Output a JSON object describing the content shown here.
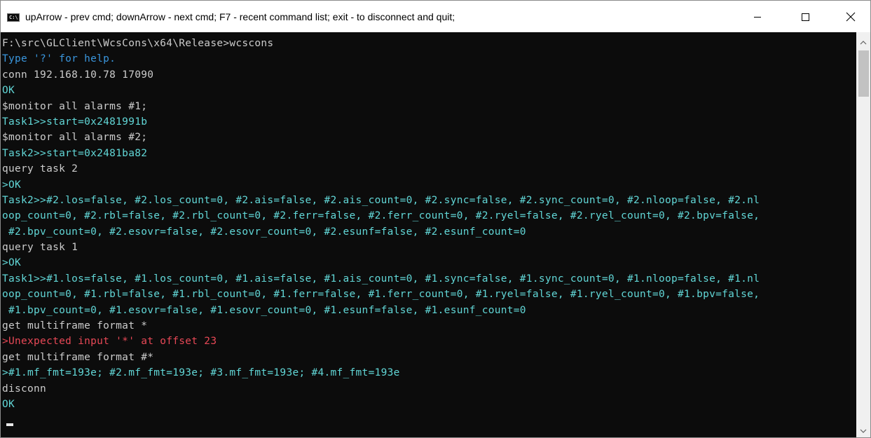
{
  "window": {
    "title": "upArrow - prev cmd; downArrow - next cmd; F7 - recent command list; exit - to disconnect and quit;",
    "icon": "console-app-icon",
    "icon_label": "C:\\",
    "controls": [
      "minimize-icon",
      "maximize-icon",
      "close-icon"
    ]
  },
  "console": {
    "lines": [
      {
        "text": "F:\\src\\GLClient\\WcsCons\\x64\\Release>wcscons",
        "color": "#cccccc"
      },
      {
        "text": "Type '?' for help.",
        "color": "#3a96dd"
      },
      {
        "text": "conn 192.168.10.78 17090",
        "color": "#cccccc"
      },
      {
        "text": "OK",
        "color": "#61d6d6"
      },
      {
        "text": "$monitor all alarms #1;",
        "color": "#cccccc"
      },
      {
        "text": "Task1>>start=0x2481991b",
        "color": "#61d6d6"
      },
      {
        "text": "$monitor all alarms #2;",
        "color": "#cccccc"
      },
      {
        "text": "Task2>>start=0x2481ba82",
        "color": "#61d6d6"
      },
      {
        "text": "query task 2",
        "color": "#cccccc"
      },
      {
        "text": ">OK",
        "color": "#61d6d6"
      },
      {
        "text": "Task2>>#2.los=false, #2.los_count=0, #2.ais=false, #2.ais_count=0, #2.sync=false, #2.sync_count=0, #2.nloop=false, #2.nl",
        "color": "#61d6d6"
      },
      {
        "text": "oop_count=0, #2.rbl=false, #2.rbl_count=0, #2.ferr=false, #2.ferr_count=0, #2.ryel=false, #2.ryel_count=0, #2.bpv=false,",
        "color": "#61d6d6"
      },
      {
        "text": " #2.bpv_count=0, #2.esovr=false, #2.esovr_count=0, #2.esunf=false, #2.esunf_count=0",
        "color": "#61d6d6"
      },
      {
        "text": "query task 1",
        "color": "#cccccc"
      },
      {
        "text": ">OK",
        "color": "#61d6d6"
      },
      {
        "text": "Task1>>#1.los=false, #1.los_count=0, #1.ais=false, #1.ais_count=0, #1.sync=false, #1.sync_count=0, #1.nloop=false, #1.nl",
        "color": "#61d6d6"
      },
      {
        "text": "oop_count=0, #1.rbl=false, #1.rbl_count=0, #1.ferr=false, #1.ferr_count=0, #1.ryel=false, #1.ryel_count=0, #1.bpv=false,",
        "color": "#61d6d6"
      },
      {
        "text": " #1.bpv_count=0, #1.esovr=false, #1.esovr_count=0, #1.esunf=false, #1.esunf_count=0",
        "color": "#61d6d6"
      },
      {
        "text": "get multiframe format *",
        "color": "#cccccc"
      },
      {
        "text": ">Unexpected input '*' at offset 23",
        "color": "#e74856"
      },
      {
        "text": "get multiframe format #*",
        "color": "#cccccc"
      },
      {
        "text": ">#1.mf_fmt=193e; #2.mf_fmt=193e; #3.mf_fmt=193e; #4.mf_fmt=193e",
        "color": "#61d6d6"
      },
      {
        "text": "disconn",
        "color": "#cccccc"
      },
      {
        "text": "OK",
        "color": "#61d6d6"
      }
    ]
  },
  "colors": {
    "console_background": "#0c0c0c",
    "command_text": "#cccccc",
    "response_text": "#61d6d6",
    "help_text": "#3a96dd",
    "error_text": "#e74856"
  }
}
